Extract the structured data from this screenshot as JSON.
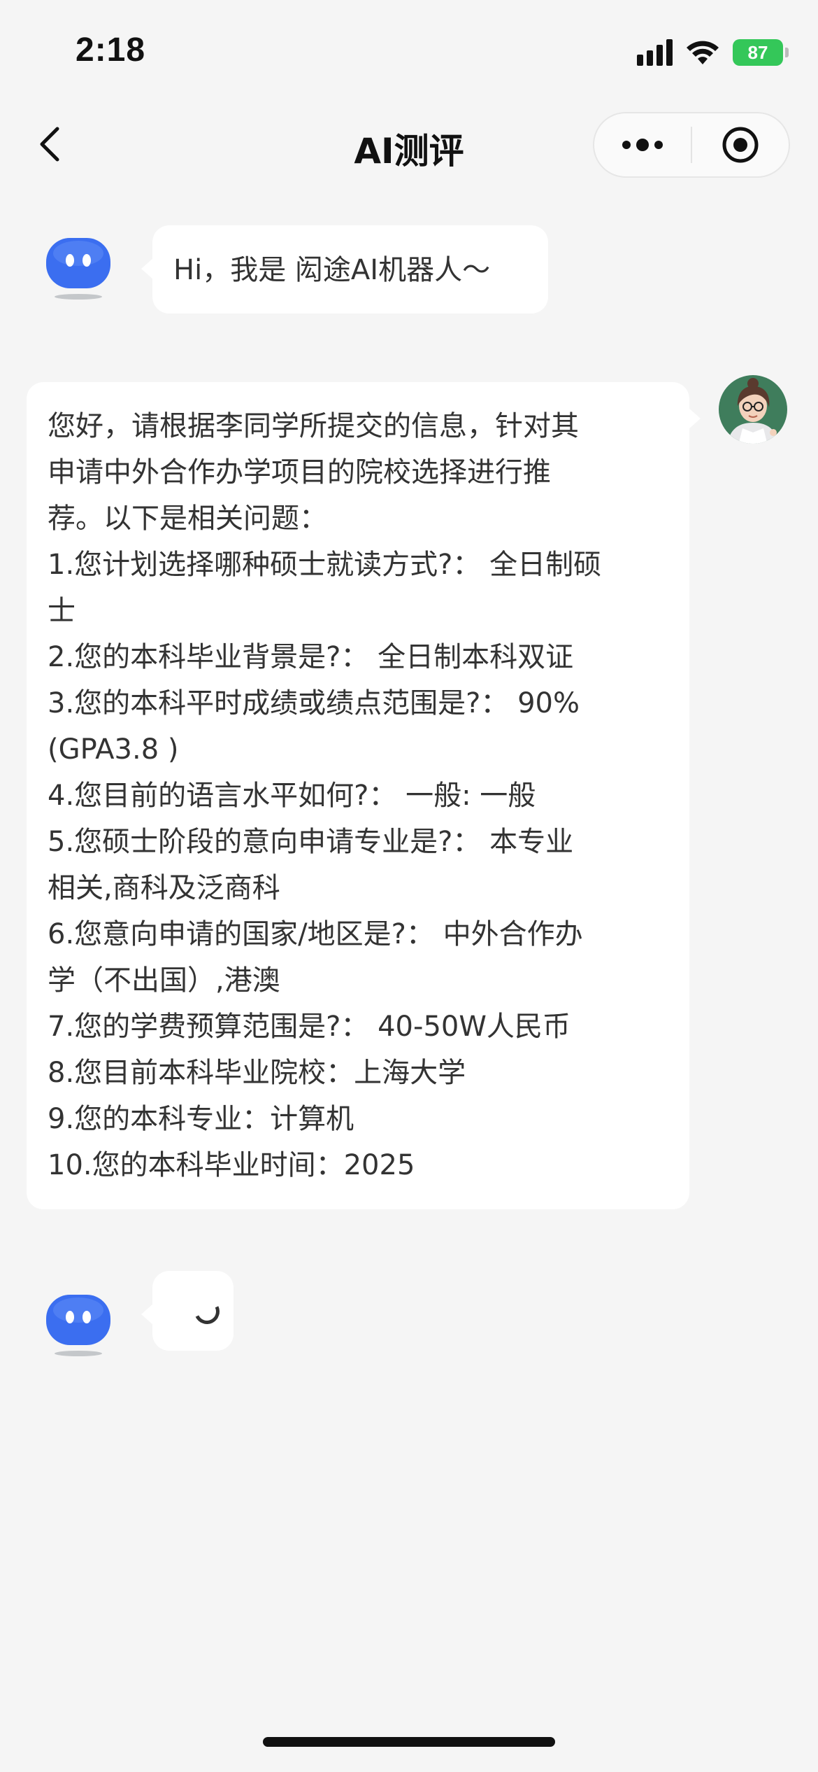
{
  "status_bar": {
    "time": "2:18",
    "battery": "87"
  },
  "nav": {
    "title": "AI测评"
  },
  "chat": {
    "greeting": "Hi，我是 闳途AI机器人～",
    "user_message_lines": [
      "您好，请根据李同学所提交的信息，针对其",
      "申请中外合作办学项目的院校选择进行推",
      "荐。以下是相关问题：",
      "1.您计划选择哪种硕士就读方式?： 全日制硕",
      "士",
      "2.您的本科毕业背景是?： 全日制本科双证",
      "3.您的本科平时成绩或绩点范围是?： 90%",
      "(GPA3.8 )",
      "4.您目前的语言水平如何?：  一般: 一般",
      "5.您硕士阶段的意向申请专业是?： 本专业",
      "相关,商科及泛商科",
      "6.您意向申请的国家/地区是?： 中外合作办",
      "学（不出国）,港澳",
      "7.您的学费预算范围是?： 40-50W人民币",
      "8.您目前本科毕业院校：上海大学",
      "9.您的本科专业：计算机",
      "10.您的本科毕业时间：2025"
    ]
  },
  "icons": {
    "back": "chevron-left-icon",
    "more": "more-dots-icon",
    "close": "target-icon",
    "bot": "robot-avatar-icon",
    "user": "user-avatar"
  },
  "colors": {
    "bot_avatar": "#3b6ef0",
    "battery": "#34c759",
    "background": "#f5f5f5"
  }
}
